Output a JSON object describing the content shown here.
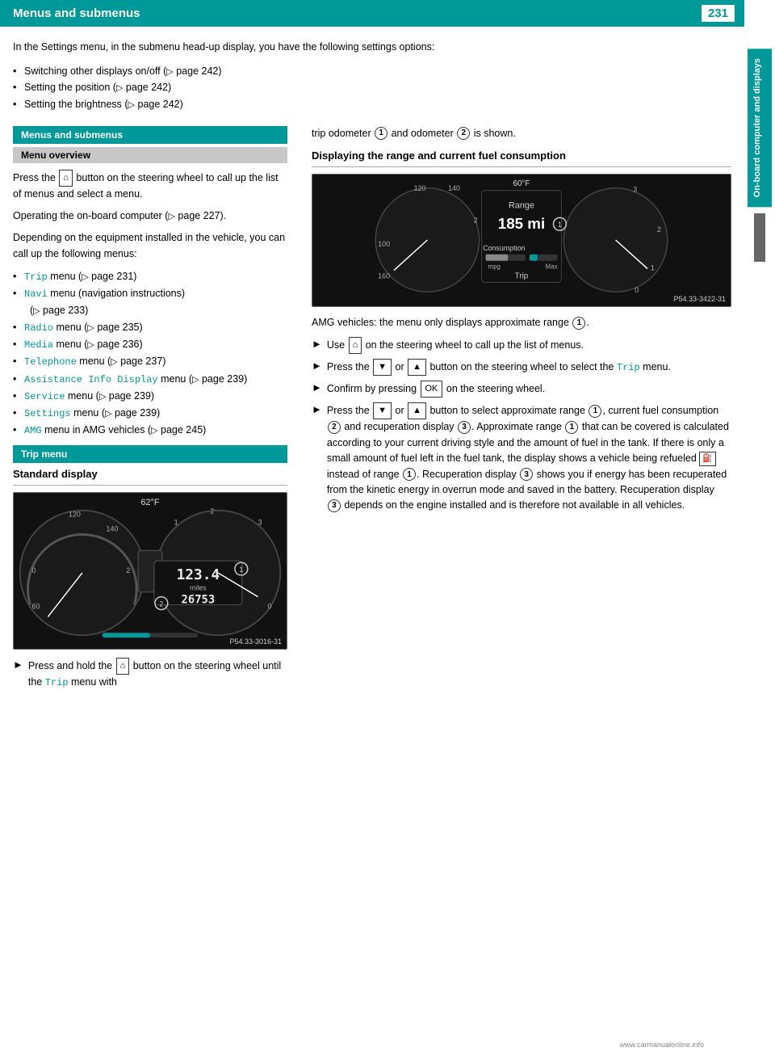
{
  "header": {
    "title": "Menus and submenus",
    "page_number": "231"
  },
  "sidebar": {
    "label": "On-board computer and displays"
  },
  "intro": {
    "text": "In the Settings menu, in the submenu head-up display, you have the following settings options:",
    "bullets": [
      "Switching other displays on/off (▷ page 242)",
      "Setting the position (▷ page 242)",
      "Setting the brightness (▷ page 242)"
    ]
  },
  "left_col": {
    "menus_and_submenus_header": "Menus and submenus",
    "menu_overview_header": "Menu overview",
    "menu_overview_text1": "Press the  button on the steering wheel to call up the list of menus and select a menu.",
    "menu_overview_text2": "Operating the on-board computer (▷ page 227).",
    "menu_overview_text3": "Depending on the equipment installed in the vehicle, you can call up the following menus:",
    "menu_items": [
      "Trip menu (▷ page 231)",
      "Navi menu (navigation instructions) (▷ page 233)",
      "Radio menu (▷ page 235)",
      "Media menu (▷ page 236)",
      "Telephone menu (▷ page 237)",
      "Assistance Info Display menu (▷ page 239)",
      "Service menu (▷ page 239)",
      "Settings menu (▷ page 239)",
      "AMG menu in AMG vehicles (▷ page 245)"
    ],
    "trip_menu_header": "Trip menu",
    "standard_display_title": "Standard display",
    "press_hold_text": "Press and hold the  button on the steering wheel until the Trip menu with",
    "img_label_left": "P54.33-3016-31"
  },
  "right_col": {
    "trip_odometer_text": "trip odometer  and odometer  is shown.",
    "range_section_title": "Displaying the range and current fuel consumption",
    "amg_text": "AMG vehicles: the menu only displays approximate range .",
    "arrow_items": [
      "Use  on the steering wheel to call up the list of menus.",
      "Press the  or  button on the steering wheel to select the Trip menu.",
      "Confirm by pressing  on the steering wheel.",
      "Press the  or  button to select approximate range , current fuel consumption  and recuperation display . Approximate range  that can be covered is calculated according to your current driving style and the amount of fuel in the tank. If there is only a small amount of fuel left in the fuel tank, the display shows a vehicle being refueled  instead of range . Recuperation display  shows you if energy has been recuperated from the kinetic energy in overrun mode and saved in the battery. Recuperation display  depends on the engine installed and is therefore not available in all vehicles."
    ],
    "img_label_right": "P54.33-3422-31"
  }
}
